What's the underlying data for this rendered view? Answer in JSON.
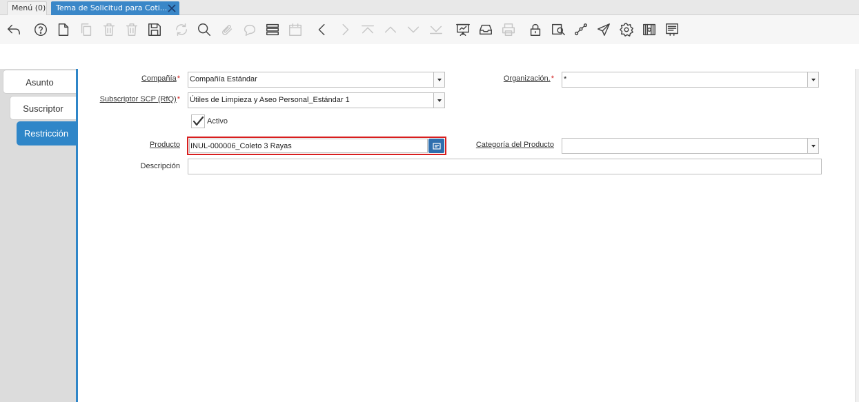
{
  "window_tabs": [
    {
      "label": "Menú (0)"
    },
    {
      "label": "Tema de Solicitud para Coti..."
    }
  ],
  "toolbar": {
    "buttons": [
      {
        "icon": "undo-icon",
        "enabled": true
      },
      {
        "icon": "help-icon",
        "enabled": true
      },
      {
        "icon": "new-record-icon",
        "enabled": true
      },
      {
        "icon": "copy-icon",
        "enabled": false
      },
      {
        "icon": "delete-icon",
        "enabled": false
      },
      {
        "icon": "delete-selection-icon",
        "enabled": false
      },
      {
        "icon": "save-icon",
        "enabled": true
      },
      {
        "icon": "refresh-icon",
        "enabled": false
      },
      {
        "icon": "find-icon",
        "enabled": true
      },
      {
        "icon": "attachment-icon",
        "enabled": false
      },
      {
        "icon": "chat-icon",
        "enabled": false
      },
      {
        "icon": "grid-toggle-icon",
        "enabled": true
      },
      {
        "icon": "calendar-icon",
        "enabled": false
      },
      {
        "icon": "previous-icon",
        "enabled": true
      },
      {
        "icon": "next-icon",
        "enabled": false
      },
      {
        "icon": "first-record-icon",
        "enabled": false
      },
      {
        "icon": "previous-record-icon",
        "enabled": false
      },
      {
        "icon": "next-record-icon",
        "enabled": false
      },
      {
        "icon": "last-record-icon",
        "enabled": false
      },
      {
        "icon": "report-icon",
        "enabled": true
      },
      {
        "icon": "archive-icon",
        "enabled": true
      },
      {
        "icon": "print-icon",
        "enabled": false
      },
      {
        "icon": "lock-icon",
        "enabled": true
      },
      {
        "icon": "zoom-across-icon",
        "enabled": true
      },
      {
        "icon": "workflow-icon",
        "enabled": true
      },
      {
        "icon": "send-icon",
        "enabled": true
      },
      {
        "icon": "settings-icon",
        "enabled": true
      },
      {
        "icon": "process-icon",
        "enabled": true
      },
      {
        "icon": "form-icon",
        "enabled": true
      }
    ]
  },
  "side_tabs": [
    {
      "label": "Asunto"
    },
    {
      "label": "Suscriptor"
    },
    {
      "label": "Restricción"
    }
  ],
  "form": {
    "compania": {
      "label": "Compañía",
      "value": "Compañía Estándar"
    },
    "organizacion": {
      "label": "Organización.",
      "value": "*"
    },
    "subscriptor": {
      "label": "Subscriptor SCP (RfQ)",
      "value": "Útiles de Limpieza y Aseo Personal_Estándar 1"
    },
    "activo": {
      "label": "Activo",
      "checked": true
    },
    "producto": {
      "label": "Producto",
      "value": "INUL-000006_Coleto 3 Rayas"
    },
    "categoria": {
      "label": "Categoría del Producto",
      "value": ""
    },
    "descripcion": {
      "label": "Descripción",
      "value": ""
    }
  },
  "colors": {
    "accent": "#2f86c8",
    "highlight": "#d81e1e",
    "required": "#d01b1b"
  }
}
